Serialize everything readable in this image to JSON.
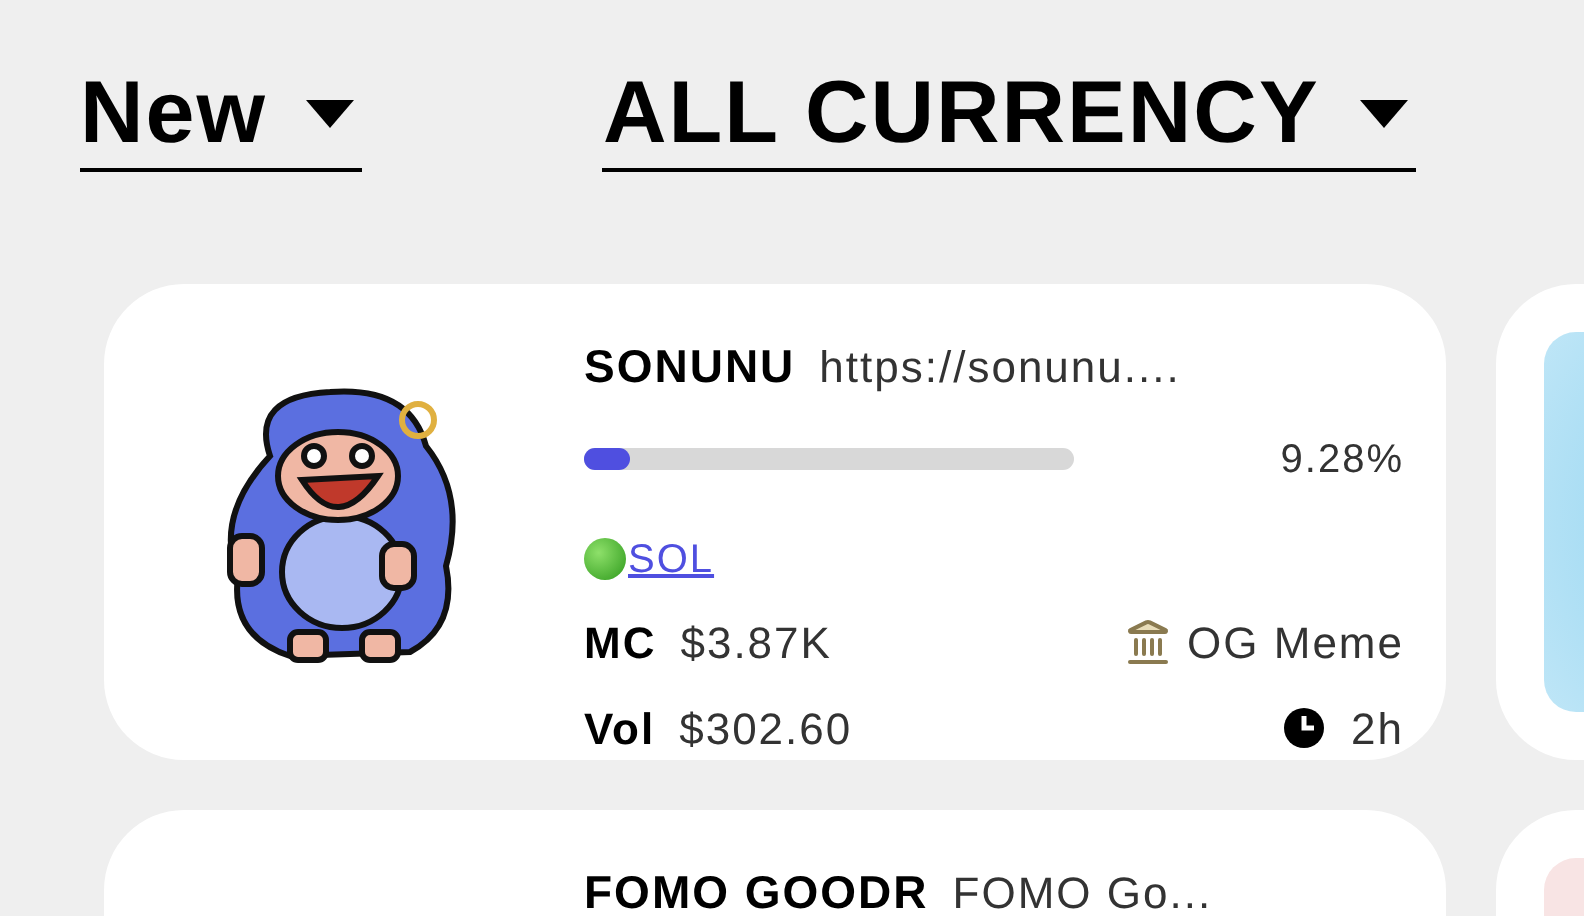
{
  "filters": [
    {
      "label": "New"
    },
    {
      "label": "ALL CURRENCY"
    }
  ],
  "tokens": [
    {
      "name": "SONUNU",
      "link": "https://sonunu....",
      "level": 0.0928,
      "progress": "9.28%",
      "chain": "SOL",
      "mc_label": "MC",
      "mc": "$3.87K",
      "category": "OG Meme",
      "vol_label": "Vol",
      "vol": "$302.60",
      "age": "2h"
    },
    {
      "name": "FOMO GOODR",
      "link": "FOMO Go..."
    }
  ]
}
